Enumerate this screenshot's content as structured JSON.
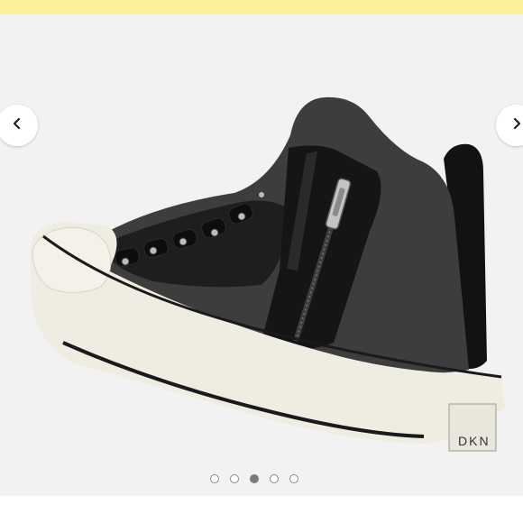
{
  "banner": {
    "color": "#fbf19a"
  },
  "gallery": {
    "prev_icon": "chevron-left-icon",
    "next_icon": "chevron-right-icon",
    "image": {
      "brand_text": "DKNY"
    },
    "slide_count": 5,
    "active_slide": 3
  }
}
